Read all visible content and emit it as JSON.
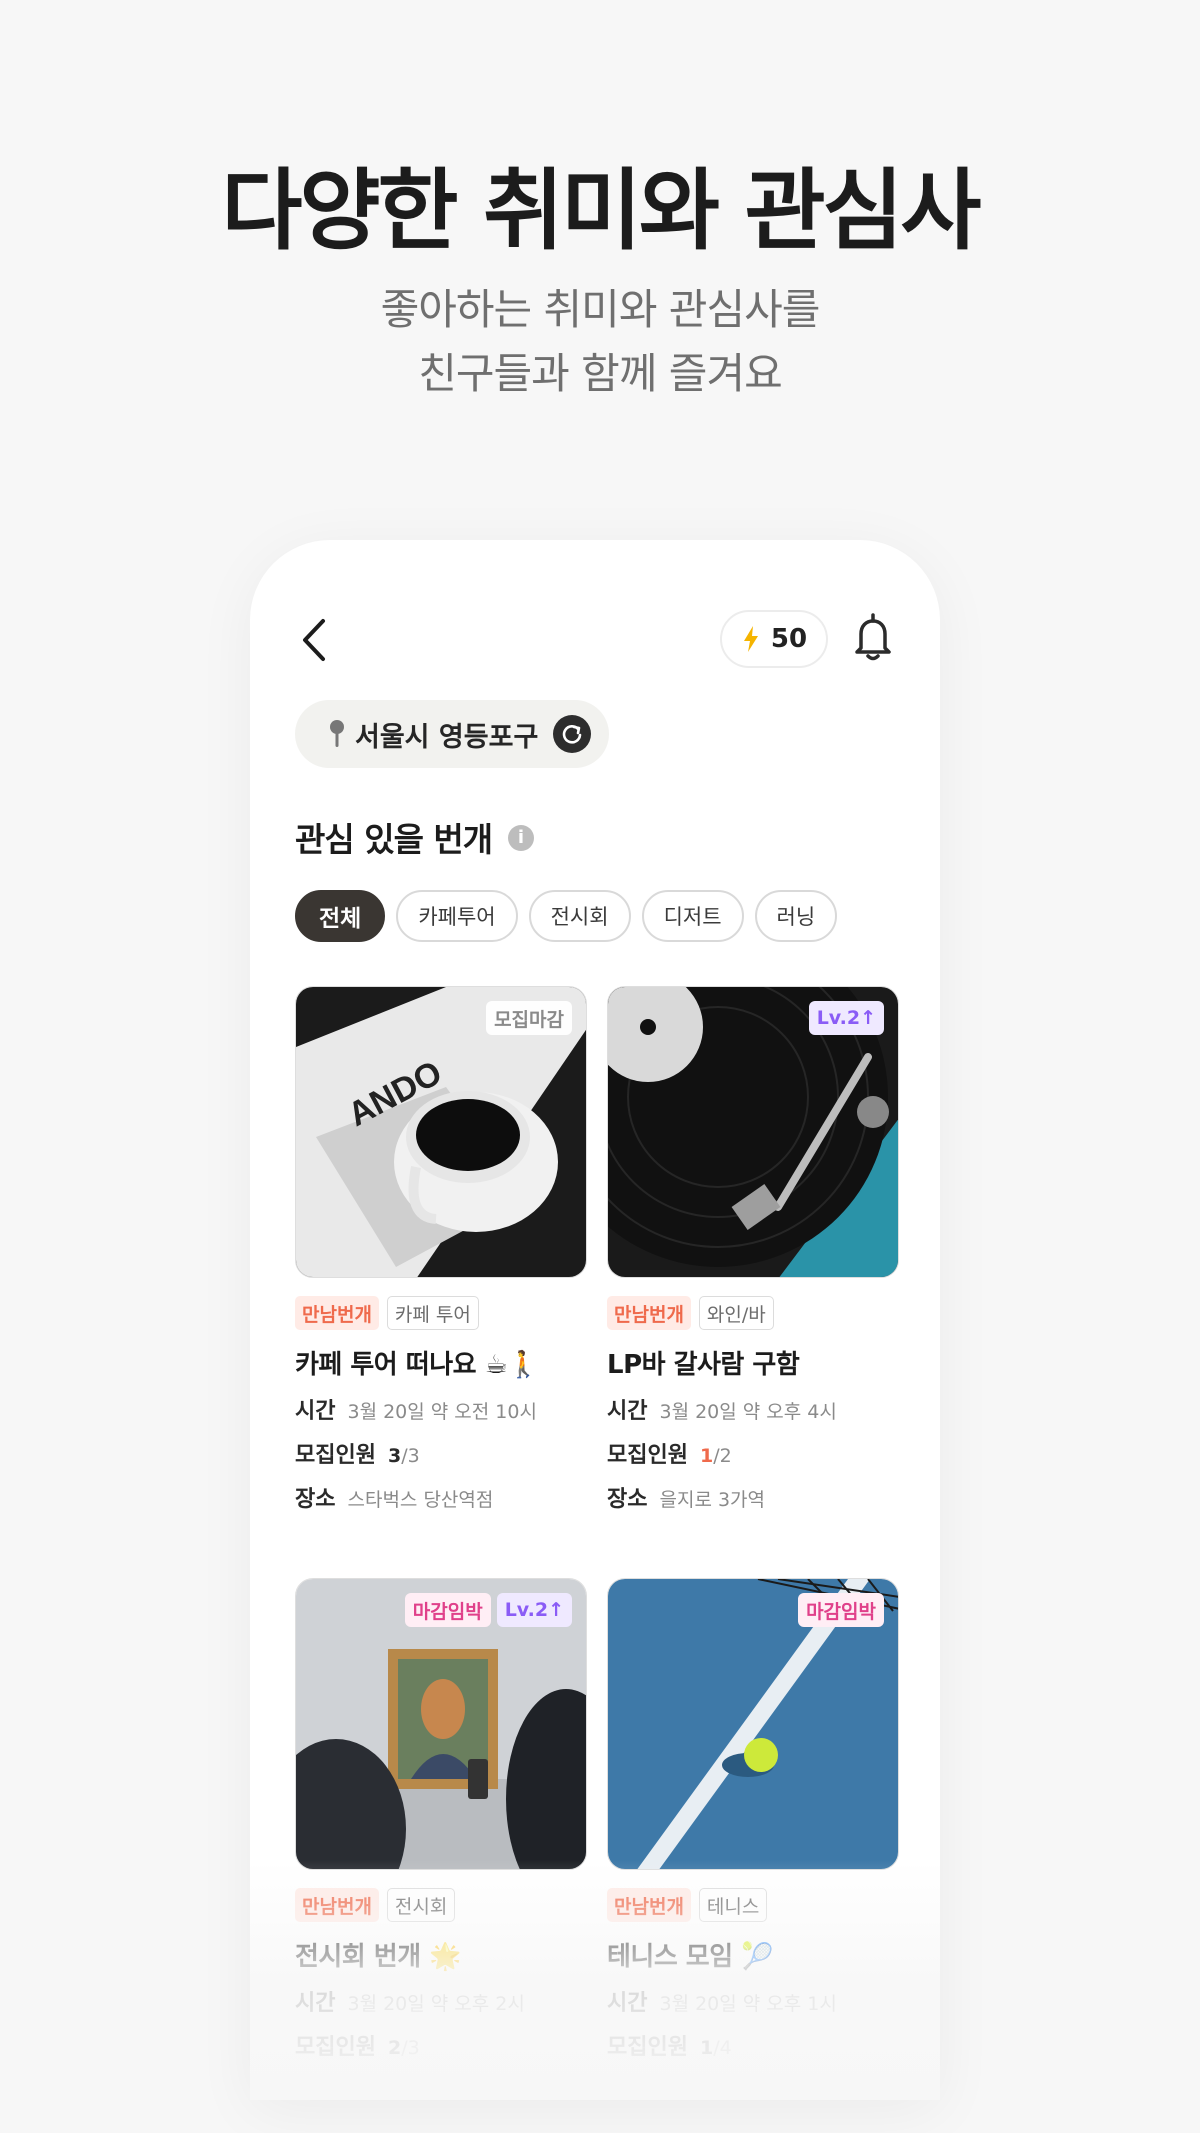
{
  "headline": "다양한 취미와 관심사",
  "subline": [
    "좋아하는 취미와 관심사를",
    "친구들과 함께 즐겨요"
  ],
  "header": {
    "coin_count": "50"
  },
  "location": {
    "label": "서울시 영등포구"
  },
  "section": {
    "title": "관심 있을 번개"
  },
  "chips": [
    "전체",
    "카페투어",
    "전시회",
    "디저트",
    "러닝"
  ],
  "cards": [
    {
      "badges": [
        "모집마감"
      ],
      "tags": [
        "만남번개",
        "카페 투어"
      ],
      "title": "카페 투어 떠나요 ☕🚶",
      "time_label": "시간",
      "time": "3월 20일 약 오전 10시",
      "people_label": "모집인원",
      "people_current": "3",
      "people_total": "/3",
      "place_label": "장소",
      "place": "스타벅스 당산역점"
    },
    {
      "badges": [
        "Lv.2↑"
      ],
      "tags": [
        "만남번개",
        "와인/바"
      ],
      "title": "LP바 갈사람 구함",
      "time_label": "시간",
      "time": "3월 20일 약 오후 4시",
      "people_label": "모집인원",
      "people_current": "1",
      "people_total": "/2",
      "place_label": "장소",
      "place": "을지로 3가역"
    },
    {
      "badges": [
        "마감임박",
        "Lv.2↑"
      ],
      "tags": [
        "만남번개",
        "전시회"
      ],
      "title": "전시회 번개 🌟",
      "time_label": "시간",
      "time": "3월 20일 약 오후 2시",
      "people_label": "모집인원",
      "people_current": "2",
      "people_total": "/3"
    },
    {
      "badges": [
        "마감임박"
      ],
      "tags": [
        "만남번개",
        "테니스"
      ],
      "title": "테니스 모임 🎾",
      "time_label": "시간",
      "time": "3월 20일 약 오후 1시",
      "people_label": "모집인원",
      "people_current": "1",
      "people_total": "/4"
    }
  ],
  "colors": {
    "accent_orange": "#ef6a4c",
    "level_purple": "#8a5cf6",
    "deadline_pink": "#e0408a",
    "coin_yellow": "#f5b400"
  }
}
